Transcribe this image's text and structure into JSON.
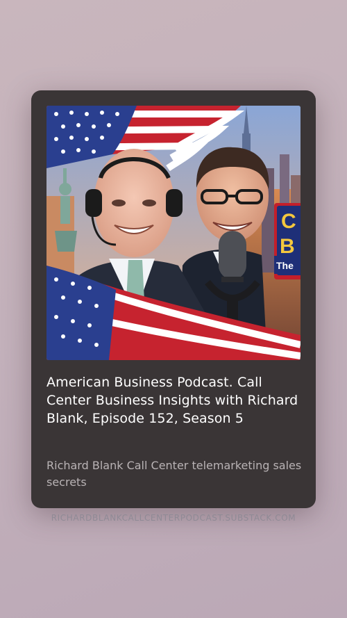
{
  "card": {
    "title": "American Business Podcast. Call Center Business Insights with Richard Blank, Episode 152, Season 5",
    "subtitle": "Richard Blank Call Center telemarketing sales secrets",
    "artwork": {
      "description_icon": "podcast-cover-art",
      "visible_text_fragments": [
        "C",
        "B",
        "The"
      ]
    }
  },
  "source": {
    "domain": "RICHARDBLANKCALLCENTERPODCAST.SUBSTACK.COM"
  },
  "colors": {
    "card_bg": "#3a3536",
    "title": "#ffffff",
    "subtitle": "#b9b3b5",
    "source": "#8f8a95"
  }
}
